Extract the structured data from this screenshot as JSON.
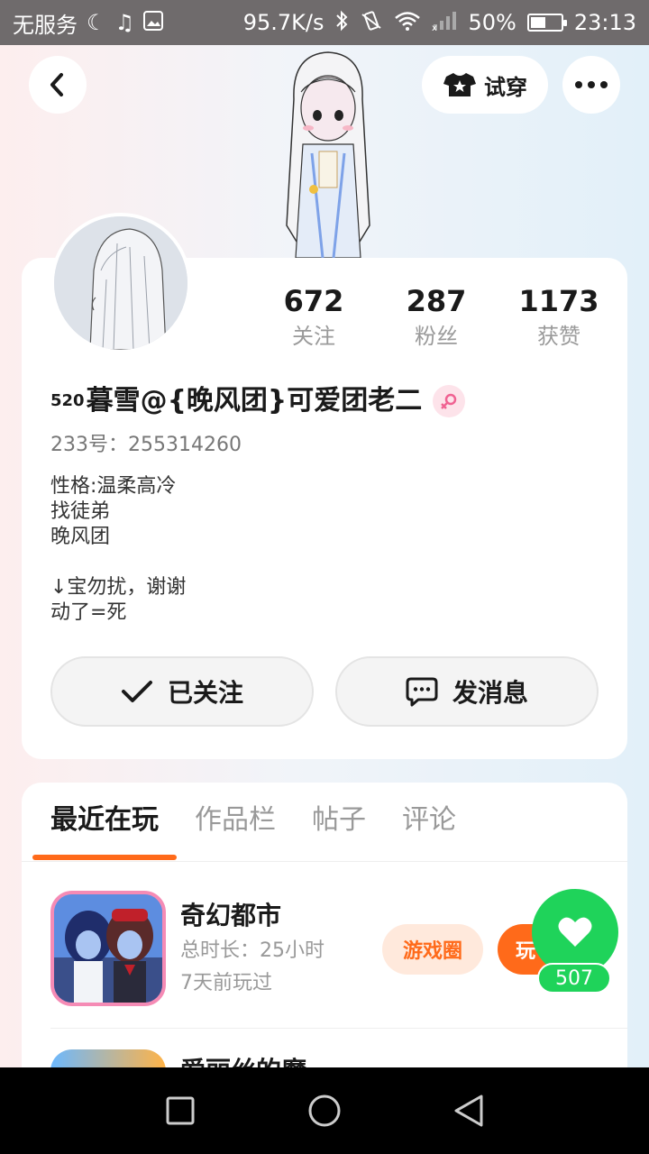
{
  "status_bar": {
    "carrier": "无服务",
    "speed": "95.7K/s",
    "battery": "50%",
    "battery_level": 0.5,
    "time": "23:13"
  },
  "header": {
    "try_on_label": "试穿"
  },
  "profile": {
    "stats": [
      {
        "value": "672",
        "label": "关注"
      },
      {
        "value": "287",
        "label": "粉丝"
      },
      {
        "value": "1173",
        "label": "获赞"
      }
    ],
    "nickname_prefix": "520",
    "nickname": "暮雪@{晚风团}可爱团老二",
    "gender": "female",
    "uid": "233号：255314260",
    "bio_lines": [
      "性格:温柔高冷",
      "找徒弟",
      "晚风团",
      "",
      "↓宝勿扰，谢谢",
      "动了=死"
    ],
    "followed_label": "已关注",
    "message_label": "发消息"
  },
  "tabs": [
    {
      "label": "最近在玩",
      "active": true
    },
    {
      "label": "作品栏",
      "active": false
    },
    {
      "label": "帖子",
      "active": false
    },
    {
      "label": "评论",
      "active": false
    }
  ],
  "games": [
    {
      "name": "奇幻都市",
      "duration": "总时长：25小时",
      "last_played": "7天前玩过",
      "circle_label": "游戏圈",
      "play_label": "玩"
    },
    {
      "name": "爱丽丝的魔"
    }
  ],
  "like": {
    "count": "507"
  },
  "colors": {
    "accent": "#ff6a1a",
    "like_green": "#1fd35a",
    "gender_pink": "#f06292"
  }
}
